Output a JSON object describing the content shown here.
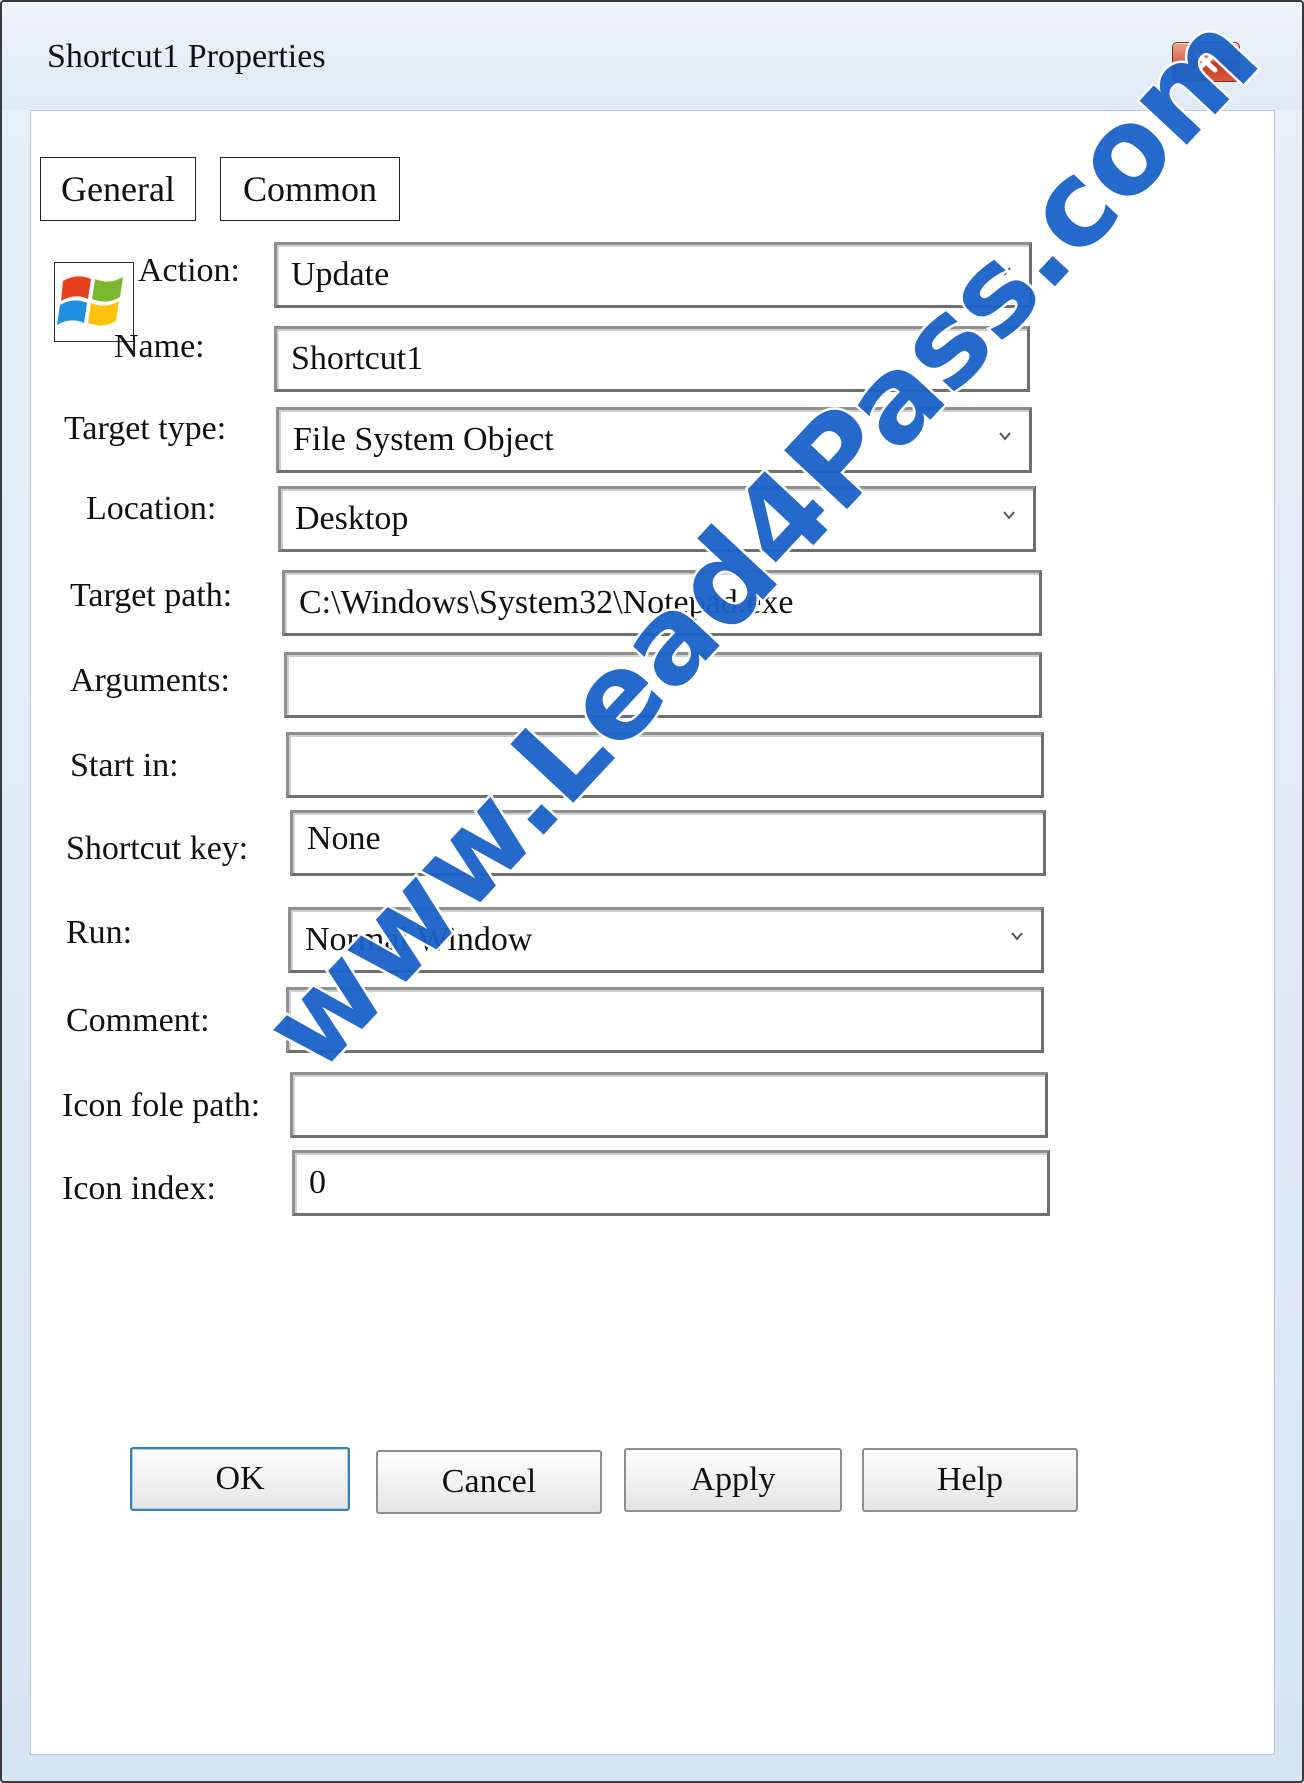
{
  "window": {
    "title": "Shortcut1 Properties",
    "close_icon": "close-x-icon"
  },
  "tabs": [
    {
      "label": "General"
    },
    {
      "label": "Common"
    }
  ],
  "app_icon": "windows-logo-icon",
  "fields": {
    "action": {
      "label": "Action:",
      "value": "Update",
      "type": "dropdown"
    },
    "name": {
      "label": "Name:",
      "value": "Shortcut1",
      "type": "text"
    },
    "target_type": {
      "label": "Target type:",
      "value": "File System Object",
      "type": "dropdown"
    },
    "location": {
      "label": "Location:",
      "value": "Desktop",
      "type": "dropdown"
    },
    "target_path": {
      "label": "Target path:",
      "value": "C:\\Windows\\System32\\Notepad.exe",
      "type": "text"
    },
    "arguments": {
      "label": "Arguments:",
      "value": "",
      "type": "text"
    },
    "start_in": {
      "label": "Start in:",
      "value": "",
      "type": "text"
    },
    "shortcut_key": {
      "label": "Shortcut key:",
      "value": "None",
      "type": "text"
    },
    "run": {
      "label": "Run:",
      "value": "Normal Window",
      "type": "dropdown"
    },
    "comment": {
      "label": "Comment:",
      "value": "",
      "type": "text"
    },
    "icon_file_path": {
      "label": "Icon fole path:",
      "value": "",
      "type": "text"
    },
    "icon_index": {
      "label": "Icon index:",
      "value": "0",
      "type": "text"
    }
  },
  "buttons": {
    "ok": "OK",
    "cancel": "Cancel",
    "apply": "Apply",
    "help": "Help"
  },
  "watermark": "www.Lead4Pass.com",
  "colors": {
    "close_button": "#c9432a",
    "default_button_border": "#3c7fb1",
    "watermark": "#1a63c9"
  }
}
